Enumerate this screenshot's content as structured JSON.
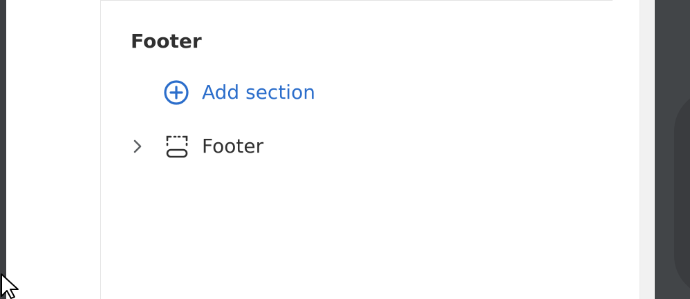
{
  "sidebar": {
    "group_title": "Footer",
    "add_section": {
      "label": "Add section",
      "icon": "circle-plus-icon"
    },
    "sections": [
      {
        "label": "Footer",
        "icon": "footer-section-icon",
        "expanded": false
      }
    ]
  },
  "colors": {
    "accent": "#2c6ecb",
    "text": "#303030",
    "panel_background": "#ffffff",
    "editor_background": "#424548"
  }
}
